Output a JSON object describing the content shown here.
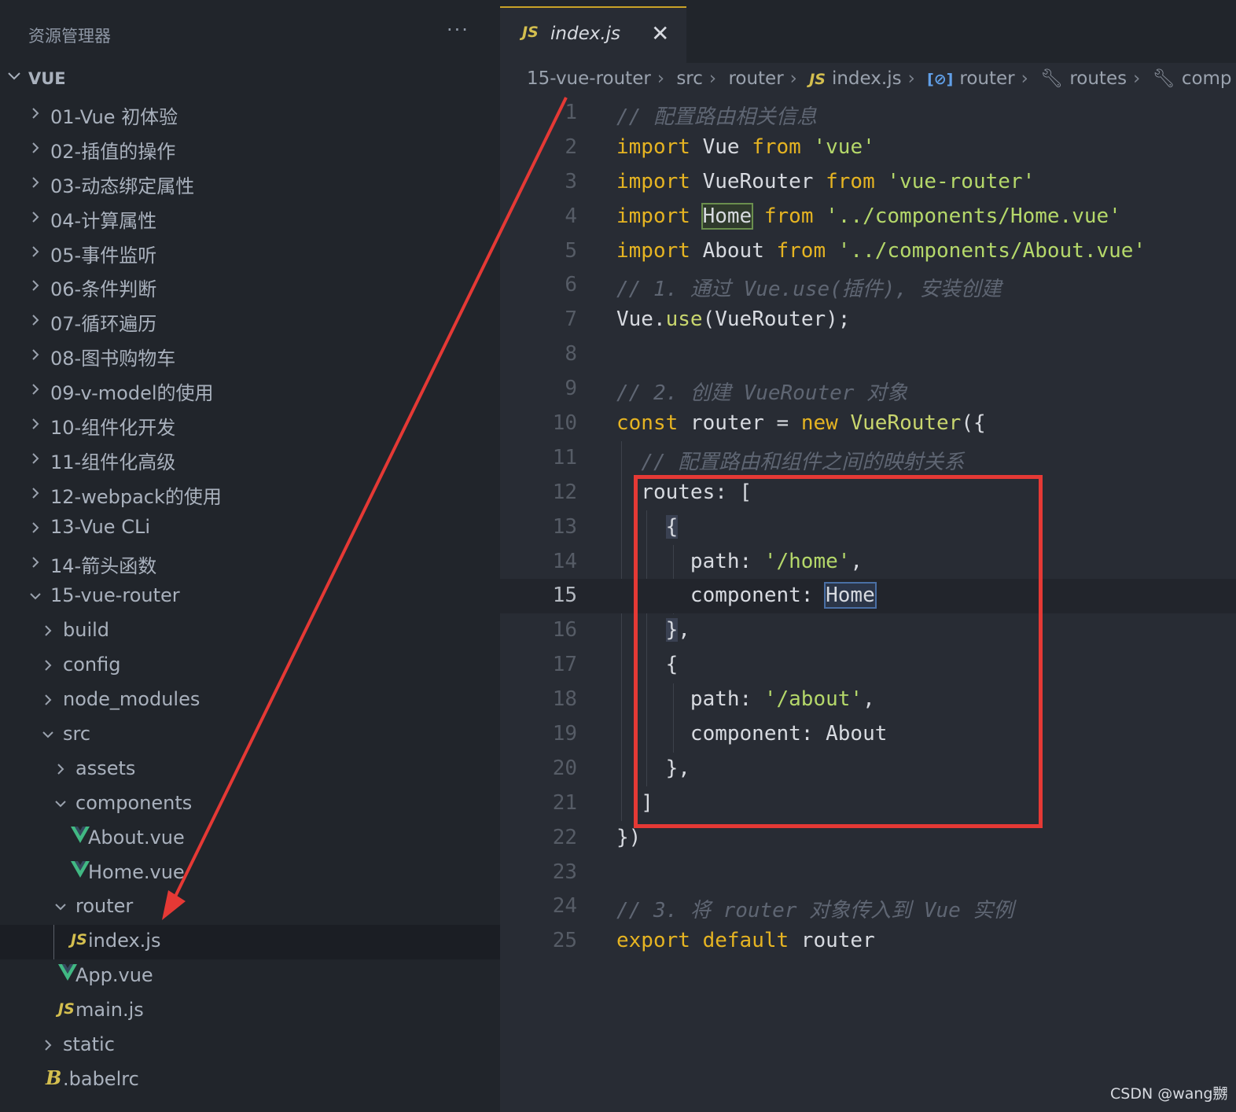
{
  "sidebar": {
    "title": "资源管理器",
    "more_label": "···",
    "workspace": "VUE",
    "items": [
      {
        "label": "01-Vue 初体验",
        "level": 0,
        "state": "collapsed",
        "icon": "chevron-right-icon"
      },
      {
        "label": "02-插值的操作",
        "level": 0,
        "state": "collapsed",
        "icon": "chevron-right-icon"
      },
      {
        "label": "03-动态绑定属性",
        "level": 0,
        "state": "collapsed",
        "icon": "chevron-right-icon"
      },
      {
        "label": "04-计算属性",
        "level": 0,
        "state": "collapsed",
        "icon": "chevron-right-icon"
      },
      {
        "label": "05-事件监听",
        "level": 0,
        "state": "collapsed",
        "icon": "chevron-right-icon"
      },
      {
        "label": "06-条件判断",
        "level": 0,
        "state": "collapsed",
        "icon": "chevron-right-icon"
      },
      {
        "label": "07-循环遍历",
        "level": 0,
        "state": "collapsed",
        "icon": "chevron-right-icon"
      },
      {
        "label": "08-图书购物车",
        "level": 0,
        "state": "collapsed",
        "icon": "chevron-right-icon"
      },
      {
        "label": "09-v-model的使用",
        "level": 0,
        "state": "collapsed",
        "icon": "chevron-right-icon"
      },
      {
        "label": "10-组件化开发",
        "level": 0,
        "state": "collapsed",
        "icon": "chevron-right-icon"
      },
      {
        "label": "11-组件化高级",
        "level": 0,
        "state": "collapsed",
        "icon": "chevron-right-icon"
      },
      {
        "label": "12-webpack的使用",
        "level": 0,
        "state": "collapsed",
        "icon": "chevron-right-icon"
      },
      {
        "label": "13-Vue CLi",
        "level": 0,
        "state": "collapsed",
        "icon": "chevron-right-icon"
      },
      {
        "label": "14-箭头函数",
        "level": 0,
        "state": "collapsed",
        "icon": "chevron-right-icon"
      },
      {
        "label": "15-vue-router",
        "level": 0,
        "state": "expanded",
        "icon": "chevron-down-icon"
      },
      {
        "label": "build",
        "level": 1,
        "state": "collapsed",
        "icon": "chevron-right-icon"
      },
      {
        "label": "config",
        "level": 1,
        "state": "collapsed",
        "icon": "chevron-right-icon"
      },
      {
        "label": "node_modules",
        "level": 1,
        "state": "collapsed",
        "icon": "chevron-right-icon"
      },
      {
        "label": "src",
        "level": 1,
        "state": "expanded",
        "icon": "chevron-down-icon"
      },
      {
        "label": "assets",
        "level": 2,
        "state": "collapsed",
        "icon": "chevron-right-icon"
      },
      {
        "label": "components",
        "level": 2,
        "state": "expanded",
        "icon": "chevron-down-icon"
      },
      {
        "label": "About.vue",
        "level": 3,
        "state": "file",
        "icon": "vue-file-icon"
      },
      {
        "label": "Home.vue",
        "level": 3,
        "state": "file",
        "icon": "vue-file-icon"
      },
      {
        "label": "router",
        "level": 2,
        "state": "expanded",
        "icon": "chevron-down-icon"
      },
      {
        "label": "index.js",
        "level": 3,
        "state": "file",
        "icon": "js-file-icon",
        "selected": true
      },
      {
        "label": "App.vue",
        "level": 2,
        "state": "file",
        "icon": "vue-file-icon"
      },
      {
        "label": "main.js",
        "level": 2,
        "state": "file",
        "icon": "js-file-icon"
      },
      {
        "label": "static",
        "level": 1,
        "state": "collapsed",
        "icon": "chevron-right-icon"
      },
      {
        "label": ".babelrc",
        "level": 1,
        "state": "file",
        "icon": "babel-file-icon"
      }
    ]
  },
  "editor": {
    "tab": {
      "icon_text": "JS",
      "label": "index.js",
      "close": "✕"
    },
    "breadcrumb": {
      "folder1": "15-vue-router",
      "folder2": "src",
      "folder3": "router",
      "file_icon": "JS",
      "file": "index.js",
      "symbol_icon": "[⊘]",
      "symbol": "router",
      "prop1": "routes",
      "prop2": "comp"
    },
    "current_line": 15,
    "lines": [
      {
        "n": "1",
        "tokens": [
          [
            "cm",
            "// 配置路由相关信息"
          ]
        ]
      },
      {
        "n": "2",
        "tokens": [
          [
            "kw",
            "import"
          ],
          [
            "id",
            " Vue "
          ],
          [
            "kw",
            "from"
          ],
          [
            "id",
            " "
          ],
          [
            "str",
            "'vue'"
          ]
        ]
      },
      {
        "n": "3",
        "tokens": [
          [
            "kw",
            "import"
          ],
          [
            "id",
            " VueRouter "
          ],
          [
            "kw",
            "from"
          ],
          [
            "id",
            " "
          ],
          [
            "str",
            "'vue-router'"
          ]
        ]
      },
      {
        "n": "4",
        "tokens": [
          [
            "kw",
            "import"
          ],
          [
            "id",
            " "
          ],
          [
            "id hl-box",
            "Home"
          ],
          [
            "id",
            " "
          ],
          [
            "kw",
            "from"
          ],
          [
            "id",
            " "
          ],
          [
            "str",
            "'../components/Home.vue'"
          ]
        ]
      },
      {
        "n": "5",
        "tokens": [
          [
            "kw",
            "import"
          ],
          [
            "id",
            " About "
          ],
          [
            "kw",
            "from"
          ],
          [
            "id",
            " "
          ],
          [
            "str",
            "'../components/About.vue'"
          ]
        ]
      },
      {
        "n": "6",
        "tokens": [
          [
            "cm",
            "// 1. 通过 Vue.use(插件), 安装创建"
          ]
        ]
      },
      {
        "n": "7",
        "tokens": [
          [
            "id",
            "Vue."
          ],
          [
            "fn",
            "use"
          ],
          [
            "id",
            "(VueRouter);"
          ]
        ]
      },
      {
        "n": "8",
        "tokens": []
      },
      {
        "n": "9",
        "tokens": [
          [
            "cm",
            "// 2. 创建 VueRouter 对象"
          ]
        ]
      },
      {
        "n": "10",
        "tokens": [
          [
            "kw",
            "const"
          ],
          [
            "id",
            " router = "
          ],
          [
            "kw",
            "new"
          ],
          [
            "id",
            " "
          ],
          [
            "fn",
            "VueRouter"
          ],
          [
            "id",
            "({"
          ]
        ]
      },
      {
        "n": "11",
        "tokens": [
          [
            "id",
            "  "
          ],
          [
            "cm",
            "// 配置路由和组件之间的映射关系"
          ]
        ]
      },
      {
        "n": "12",
        "tokens": [
          [
            "id",
            "  routes: ["
          ]
        ]
      },
      {
        "n": "13",
        "tokens": [
          [
            "id",
            "    "
          ],
          [
            "id hl-brace",
            "{"
          ]
        ]
      },
      {
        "n": "14",
        "tokens": [
          [
            "id",
            "      path: "
          ],
          [
            "str",
            "'/home'"
          ],
          [
            "id",
            ","
          ]
        ]
      },
      {
        "n": "15",
        "tokens": [
          [
            "id",
            "      component: "
          ],
          [
            "id hl-blue",
            "Home"
          ]
        ]
      },
      {
        "n": "16",
        "tokens": [
          [
            "id",
            "    "
          ],
          [
            "id hl-brace",
            "}"
          ],
          [
            "id",
            ","
          ]
        ]
      },
      {
        "n": "17",
        "tokens": [
          [
            "id",
            "    {"
          ]
        ]
      },
      {
        "n": "18",
        "tokens": [
          [
            "id",
            "      path: "
          ],
          [
            "str",
            "'/about'"
          ],
          [
            "id",
            ","
          ]
        ]
      },
      {
        "n": "19",
        "tokens": [
          [
            "id",
            "      component: About"
          ]
        ]
      },
      {
        "n": "20",
        "tokens": [
          [
            "id",
            "    },"
          ]
        ]
      },
      {
        "n": "21",
        "tokens": [
          [
            "id",
            "  ]"
          ]
        ]
      },
      {
        "n": "22",
        "tokens": [
          [
            "id",
            "})"
          ]
        ]
      },
      {
        "n": "23",
        "tokens": []
      },
      {
        "n": "24",
        "tokens": [
          [
            "cm",
            "// 3. 将 router 对象传入到 Vue 实例"
          ]
        ]
      },
      {
        "n": "25",
        "tokens": [
          [
            "kw",
            "export"
          ],
          [
            "id",
            " "
          ],
          [
            "kw",
            "default"
          ],
          [
            "id",
            " router"
          ]
        ]
      }
    ]
  },
  "annotation": {
    "highlight_color": "#e53935"
  },
  "watermark": "CSDN @wang嬲",
  "colors": {
    "sidebar_bg": "#21252b",
    "editor_bg": "#282c34",
    "keyword": "#e6b422",
    "string": "#b5d86a",
    "comment": "#5f6673",
    "vue_green": "#41b883",
    "js_yellow": "#d4bf4f"
  }
}
